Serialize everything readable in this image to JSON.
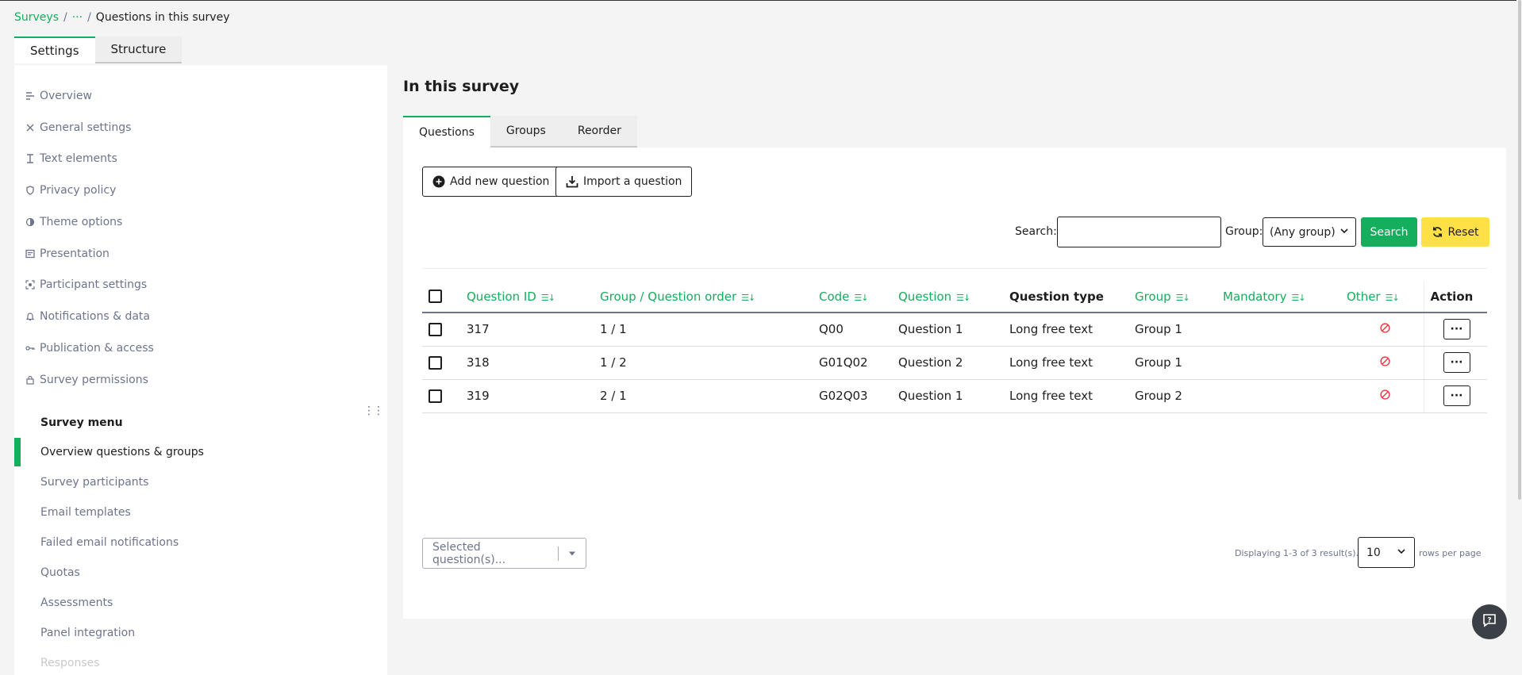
{
  "breadcrumb": {
    "root": "Surveys",
    "sep1": "/",
    "ellipsis": "···",
    "sep2": "/",
    "current": "Questions in this survey"
  },
  "side_tabs": {
    "settings": "Settings",
    "structure": "Structure"
  },
  "settings_items": [
    {
      "label": "Overview",
      "icon": "overview-icon"
    },
    {
      "label": "General settings",
      "icon": "tools-icon"
    },
    {
      "label": "Text elements",
      "icon": "text-cursor-icon"
    },
    {
      "label": "Privacy policy",
      "icon": "shield-icon"
    },
    {
      "label": "Theme options",
      "icon": "contrast-icon"
    },
    {
      "label": "Presentation",
      "icon": "presentation-icon"
    },
    {
      "label": "Participant settings",
      "icon": "participant-icon"
    },
    {
      "label": "Notifications & data",
      "icon": "bell-icon"
    },
    {
      "label": "Publication & access",
      "icon": "key-icon"
    },
    {
      "label": "Survey permissions",
      "icon": "lock-icon"
    }
  ],
  "survey_menu": {
    "title": "Survey menu",
    "items": [
      "Overview questions & groups",
      "Survey participants",
      "Email templates",
      "Failed email notifications",
      "Quotas",
      "Assessments",
      "Panel integration",
      "Responses"
    ]
  },
  "main": {
    "title": "In this survey",
    "tabs": [
      "Questions",
      "Groups",
      "Reorder"
    ],
    "add_button": "Add new question",
    "import_button": "Import a question",
    "search_label": "Search:",
    "search_value": "",
    "group_label": "Group:",
    "group_value": "(Any group)",
    "search_button": "Search",
    "reset_button": "Reset"
  },
  "table": {
    "headers": {
      "qid": "Question ID",
      "order": "Group / Question order",
      "code": "Code",
      "question": "Question",
      "type": "Question type",
      "group": "Group",
      "mandatory": "Mandatory",
      "other": "Other",
      "action": "Action"
    },
    "rows": [
      {
        "qid": "317",
        "order": "1 / 1",
        "code": "Q00",
        "question": "Question 1",
        "type": "Long free text",
        "group": "Group 1",
        "mandatory": "",
        "action": "···"
      },
      {
        "qid": "318",
        "order": "1 / 2",
        "code": "G01Q02",
        "question": "Question 2",
        "type": "Long free text",
        "group": "Group 1",
        "mandatory": "",
        "action": "···"
      },
      {
        "qid": "319",
        "order": "2 / 1",
        "code": "G02Q03",
        "question": "Question 1",
        "type": "Long free text",
        "group": "Group 2",
        "mandatory": "",
        "action": "···"
      }
    ]
  },
  "footer": {
    "bulk_placeholder": "Selected question(s)...",
    "paging_text": "Displaying 1-3 of 3 result(s).",
    "rows_value": "10",
    "rows_label": "rows per page"
  },
  "colors": {
    "accent": "#14ae5c",
    "reset": "#ffe046",
    "danger": "#e03c3c",
    "text": "#1e1e1e",
    "muted": "#6e748c"
  }
}
